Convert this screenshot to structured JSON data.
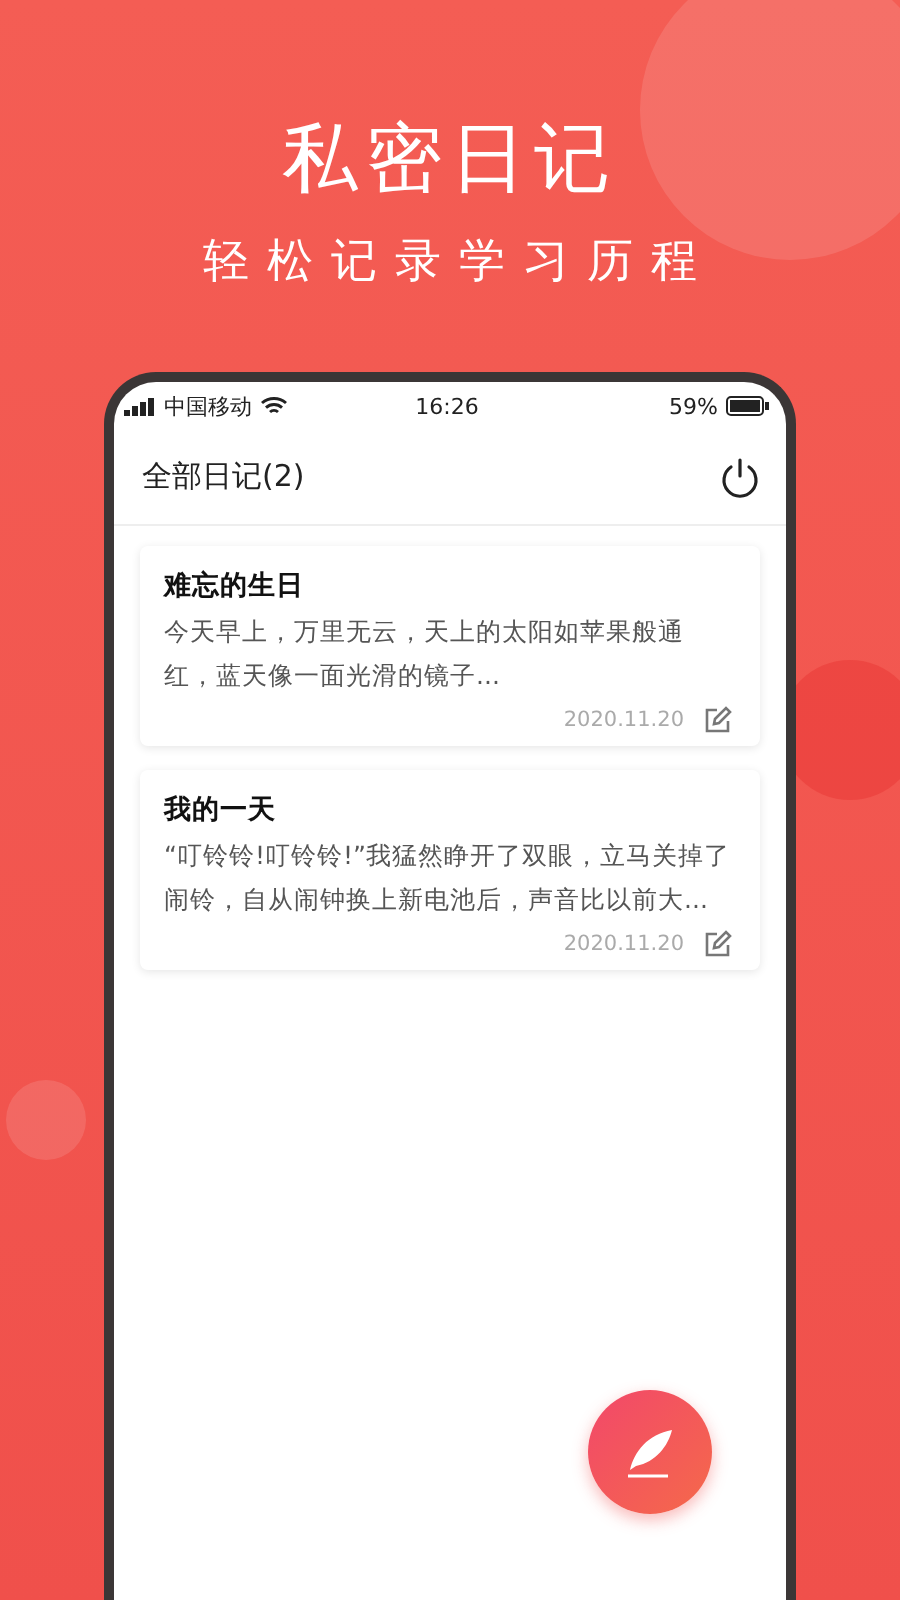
{
  "headline": {
    "title": "私密日记",
    "subtitle": "轻松记录学习历程"
  },
  "status_bar": {
    "carrier": "中国移动",
    "time": "16:26",
    "battery": "59%"
  },
  "header": {
    "title": "全部日记(2)"
  },
  "entries": [
    {
      "title": "难忘的生日",
      "excerpt": "今天早上，万里无云，天上的太阳如苹果般通红，蓝天像一面光滑的镜子...",
      "date": "2020.11.20"
    },
    {
      "title": "我的一天",
      "excerpt": "“叮铃铃!叮铃铃!”我猛然睁开了双眼，立马关掉了闹铃，自从闹钟换上新电池后，声音比以前大...",
      "date": "2020.11.20"
    }
  ]
}
